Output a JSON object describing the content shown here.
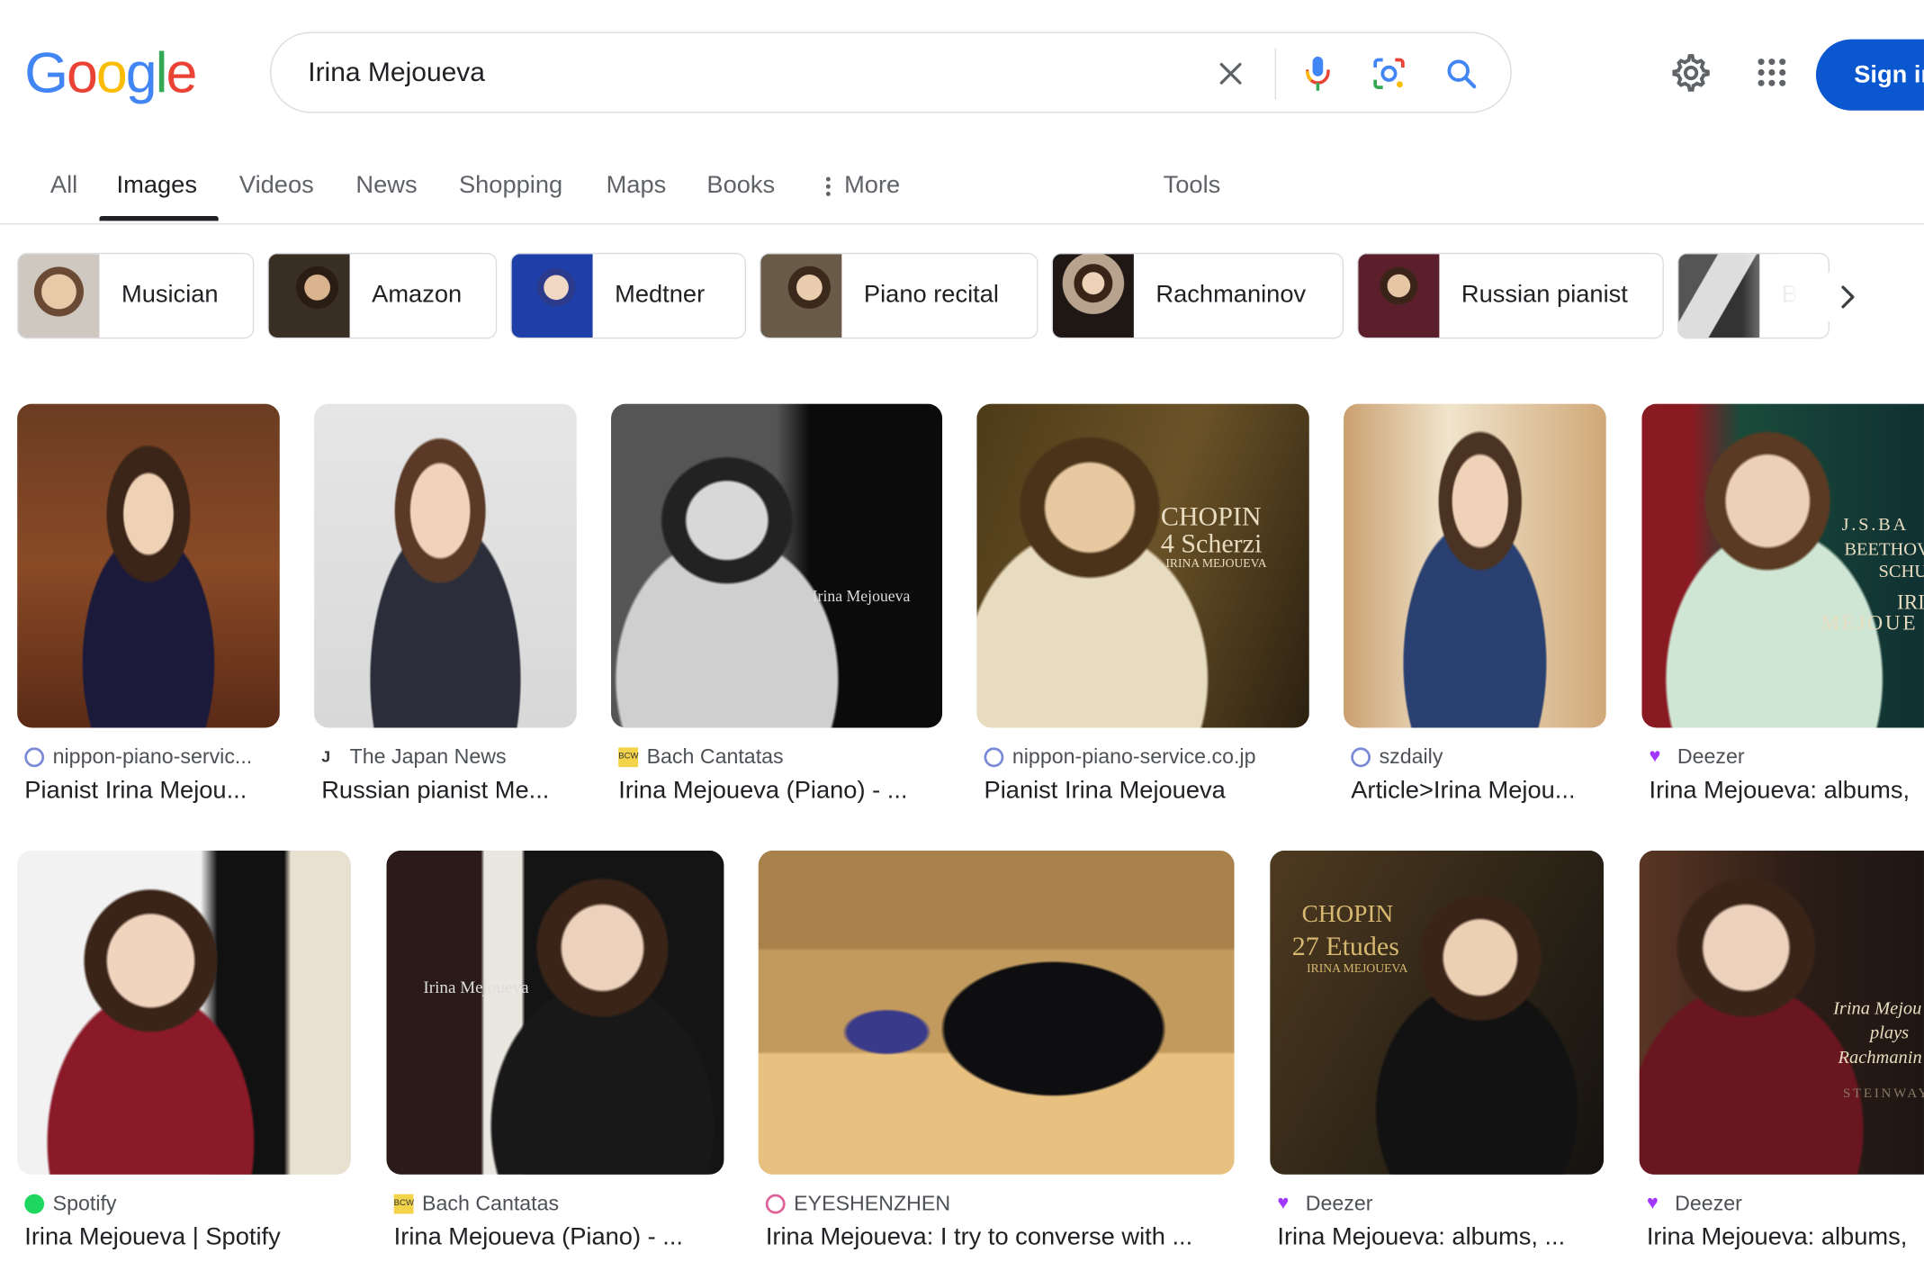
{
  "header": {
    "logo": [
      "G",
      "o",
      "o",
      "g",
      "l",
      "e"
    ],
    "logo_colors": [
      "#4285F4",
      "#EA4335",
      "#FBBC05",
      "#4285F4",
      "#34A853",
      "#EA4335"
    ],
    "search_value": "Irina Mejoueva",
    "sign_in": "Sign in"
  },
  "tabs": [
    "All",
    "Images",
    "Videos",
    "News",
    "Shopping",
    "Maps",
    "Books",
    "More",
    "Tools"
  ],
  "active_tab": "Images",
  "chips": [
    "Musician",
    "Amazon",
    "Medtner",
    "Piano recital",
    "Rachmaninov",
    "Russian pianist",
    "Be"
  ],
  "results": [
    {
      "source": "nippon-piano-servic...",
      "caption": "Pianist Irina Mejou..."
    },
    {
      "source": "The Japan News",
      "caption": "Russian pianist Me..."
    },
    {
      "source": "Bach Cantatas",
      "caption": "Irina Mejoueva (Piano) - ..."
    },
    {
      "source": "nippon-piano-service.co.jp",
      "caption": "Pianist Irina Mejoueva"
    },
    {
      "source": "szdaily",
      "caption": "Article>Irina Mejou..."
    },
    {
      "source": "Deezer",
      "caption": "Irina Mejoueva: albums,"
    },
    {
      "source": "Spotify",
      "caption": "Irina Mejoueva | Spotify"
    },
    {
      "source": "Bach Cantatas",
      "caption": "Irina Mejoueva (Piano) - ..."
    },
    {
      "source": "EYESHENZHEN",
      "caption": "Irina Mejoueva: I try to converse with ..."
    },
    {
      "source": "Deezer",
      "caption": "Irina Mejoueva: albums, ..."
    },
    {
      "source": "Deezer",
      "caption": "Irina Mejoueva: albums,"
    }
  ],
  "overlays": {
    "r3": "Irina Mejoueva",
    "r4a": "CHOPIN",
    "r4b": "4 Scherzi",
    "r4c": "IRINA MEJOUEVA",
    "r6a": "J.S.BA",
    "r6b": "BEETHOV",
    "r6c": "SCHUMA",
    "r6d": "IRI",
    "r6e": "MEJOUE",
    "r8": "Irina Mejoueva",
    "r10a": "CHOPIN",
    "r10b": "27 Etudes",
    "r10c": "IRINA MEJOUEVA",
    "r11a": "Irina Mejou",
    "r11b": "plays",
    "r11c": "Rachmanin",
    "r11d": "STEINWAY"
  }
}
